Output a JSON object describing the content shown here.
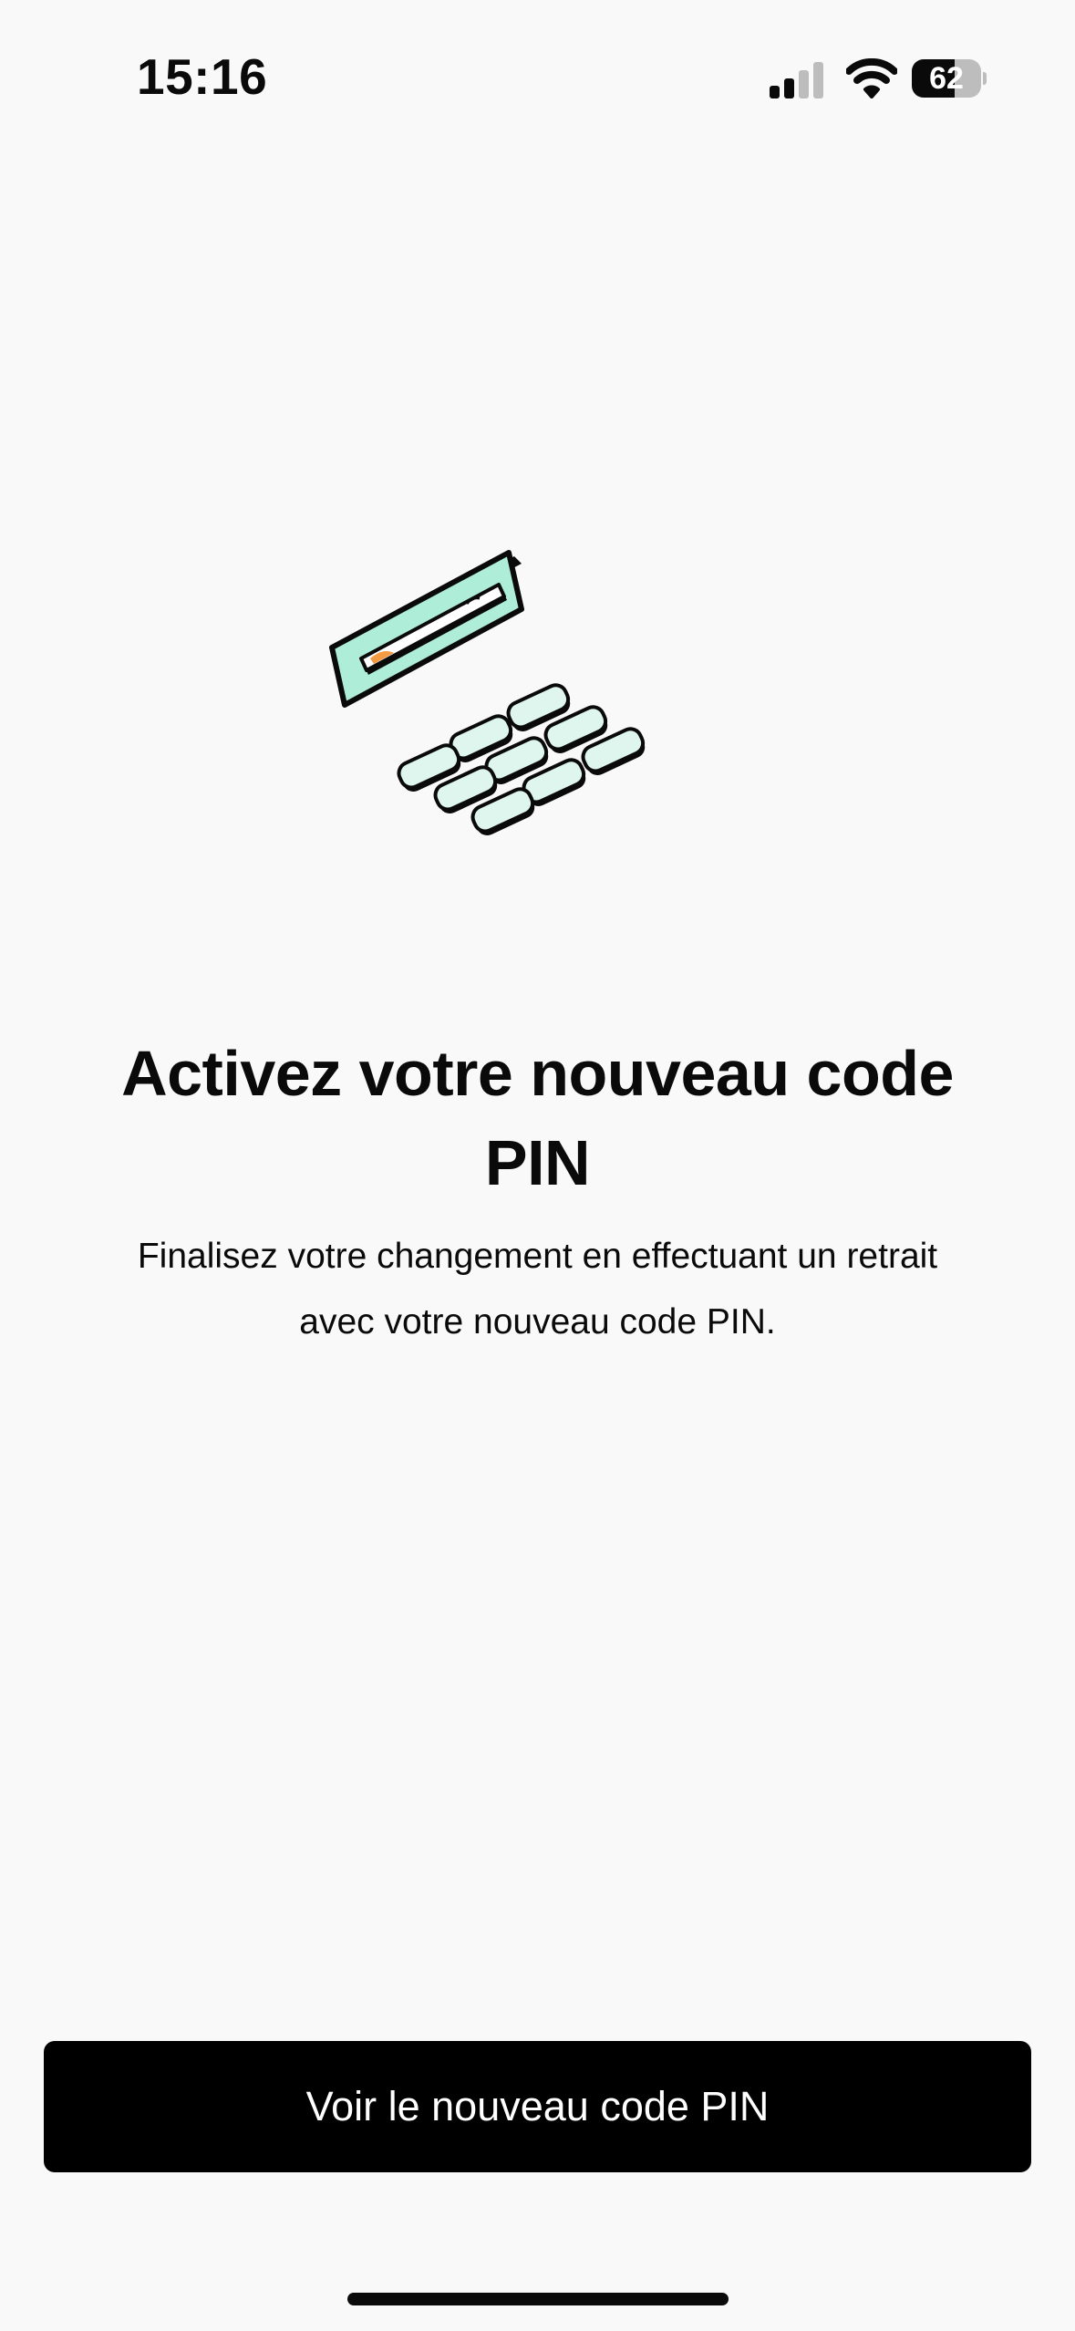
{
  "status_bar": {
    "time": "15:16",
    "battery_level": "62",
    "battery_fraction": 0.62,
    "signal_bars_active": 2,
    "signal_bars_total": 4
  },
  "illustration": {
    "icon": "atm-card-keypad-icon",
    "card_color": "#aeeed9",
    "key_color": "#def6ee",
    "accent_color": "#f39a42"
  },
  "content": {
    "title": "Activez votre nouveau code PIN",
    "subtitle": "Finalisez votre changement en effectuant un retrait avec votre nouveau code PIN."
  },
  "actions": {
    "primary_label": "Voir le nouveau code PIN"
  },
  "colors": {
    "background": "#f9f9f9",
    "text": "#0a0a0a",
    "button_background": "#000000",
    "button_text": "#ffffff"
  }
}
